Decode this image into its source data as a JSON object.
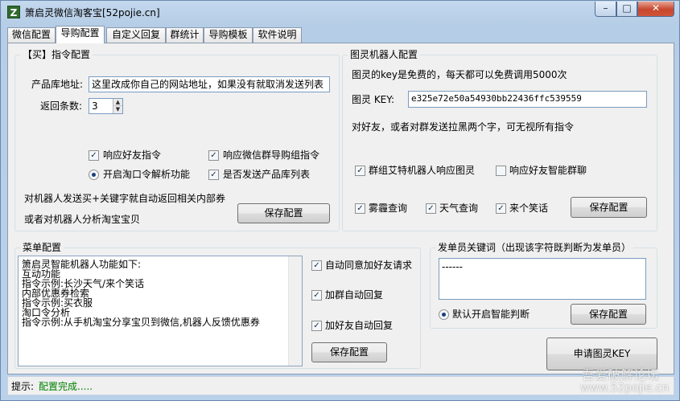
{
  "window": {
    "title": "箫启灵微信淘客宝[52pojie.cn]",
    "icon_letter": "Z",
    "controls": {
      "minimize": "–",
      "maximize": "□",
      "close": "✕"
    }
  },
  "tabs": [
    "微信配置",
    "导购配置",
    "自定义回复",
    "群统计",
    "导购模板",
    "软件说明"
  ],
  "buy_group": {
    "title": "【买】指令配置",
    "product_url_label": "产品库地址:",
    "product_url_value": "这里改成你自己的网站地址，如果没有就取消发送列表",
    "return_count_label": "返回条数:",
    "return_count_value": "3",
    "options": [
      {
        "label": "响应好友指令",
        "checked": true
      },
      {
        "label": "响应微信群导购组指令",
        "checked": true
      },
      {
        "label": "开启淘口令解析功能",
        "type": "radio",
        "checked": true
      },
      {
        "label": "是否发送产品库列表",
        "checked": true
      }
    ],
    "hint1": "对机器人发送买+关键字就自动返回相关内部券",
    "hint2": "或者对机器人分析淘宝宝贝",
    "save_label": "保存配置"
  },
  "tuling_group": {
    "title": "图灵机器人配置",
    "info": "图灵的key是免费的，每天都可以免费调用5000次",
    "key_label": "图灵 KEY:",
    "key_value": "e325e72e50a54930bb22436ffc539559",
    "blacklist_hint": "对好友，或者对群发送拉黑两个字，可无视所有指令",
    "options": [
      {
        "label": "群组艾特机器人响应图灵",
        "checked": true
      },
      {
        "label": "响应好友智能群聊",
        "checked": false
      },
      {
        "label": "雾霾查询",
        "checked": true
      },
      {
        "label": "天气查询",
        "checked": true
      },
      {
        "label": "来个笑话",
        "checked": true
      }
    ],
    "save_label": "保存配置"
  },
  "menu_group": {
    "title": "菜单配置",
    "lines": [
      "箫启灵智能机器人功能如下:",
      "互动功能",
      "指令示例:长沙天气/来个笑话",
      "内部优惠券检索",
      "指令示例:买衣服",
      "淘口令分析",
      "指令示例:从手机淘宝分享宝贝到微信,机器人反馈优惠券"
    ],
    "options": [
      {
        "label": "自动同意加好友请求",
        "checked": true
      },
      {
        "label": "加群自动回复",
        "checked": true
      },
      {
        "label": "加好友自动回复",
        "checked": true
      }
    ],
    "save_label": "保存配置"
  },
  "sender_group": {
    "title": "发单员关键词（出现该字符既判断为发单员）",
    "keyword_value": "------",
    "smart_label": "默认开启智能判断",
    "save_label": "保存配置"
  },
  "apply_key_label": "申请图灵KEY",
  "status": {
    "label": "提示:",
    "message": "配置完成....."
  },
  "status_color": "#008000",
  "watermark": {
    "line1": "吾爱破解论坛",
    "line2": "www.52pojie.cn"
  }
}
